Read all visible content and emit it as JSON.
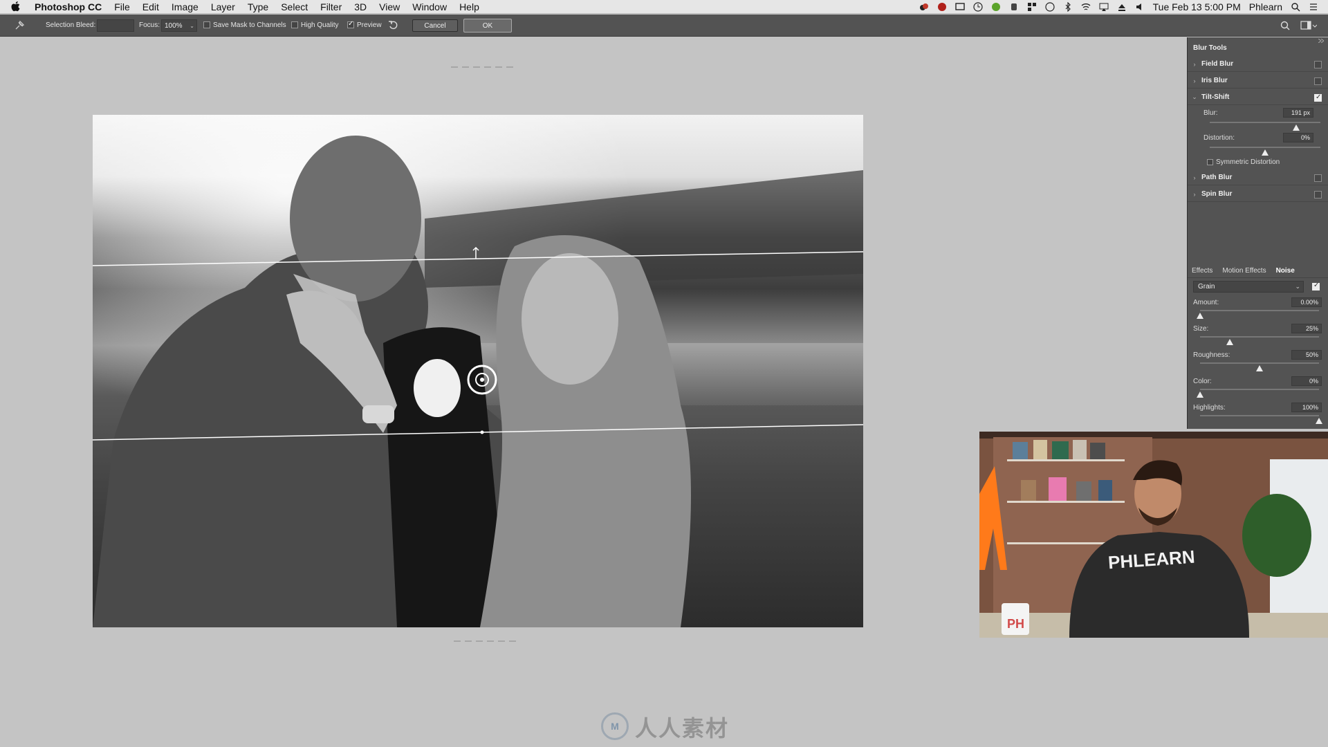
{
  "menubar": {
    "apple_icon": "apple-icon",
    "app_name": "Photoshop CC",
    "menus": [
      "File",
      "Edit",
      "Image",
      "Layer",
      "Type",
      "Select",
      "Filter",
      "3D",
      "View",
      "Window",
      "Help"
    ],
    "clock": "Tue Feb 13  5:00 PM",
    "user": "Phlearn"
  },
  "options_bar": {
    "selection_bleed_label": "Selection Bleed:",
    "focus_label": "Focus:",
    "focus_value": "100%",
    "save_mask_label": "Save Mask to Channels",
    "save_mask_checked": false,
    "high_quality_label": "High Quality",
    "high_quality_checked": false,
    "preview_label": "Preview",
    "preview_checked": true,
    "cancel_label": "Cancel",
    "ok_label": "OK"
  },
  "blur_panel": {
    "title": "Blur Tools",
    "sections": [
      {
        "name": "Field Blur",
        "expanded": false,
        "enabled": false
      },
      {
        "name": "Iris Blur",
        "expanded": false,
        "enabled": false
      },
      {
        "name": "Tilt-Shift",
        "expanded": true,
        "enabled": true
      },
      {
        "name": "Path Blur",
        "expanded": false,
        "enabled": false
      },
      {
        "name": "Spin Blur",
        "expanded": false,
        "enabled": false
      }
    ],
    "tilt_shift": {
      "blur_label": "Blur:",
      "blur_value": "191 px",
      "blur_level": 0.78,
      "distortion_label": "Distortion:",
      "distortion_value": "0%",
      "distortion_level": 0.5,
      "symmetric_label": "Symmetric Distortion",
      "symmetric_checked": false
    }
  },
  "effects_panel": {
    "tabs": [
      "Effects",
      "Motion Effects",
      "Noise"
    ],
    "active_tab": "Noise",
    "noise_type": "Grain",
    "noise_enabled": true,
    "sliders": [
      {
        "label": "Amount:",
        "value": "0.00%",
        "level": 0.0
      },
      {
        "label": "Size:",
        "value": "25%",
        "level": 0.25
      },
      {
        "label": "Roughness:",
        "value": "50%",
        "level": 0.5
      },
      {
        "label": "Color:",
        "value": "0%",
        "level": 0.0
      },
      {
        "label": "Highlights:",
        "value": "100%",
        "level": 1.0
      }
    ]
  },
  "webcam": {
    "shirt_text": "PHLEARN",
    "mug_text": "PH"
  },
  "watermark": {
    "logo_text": "人人素材"
  }
}
